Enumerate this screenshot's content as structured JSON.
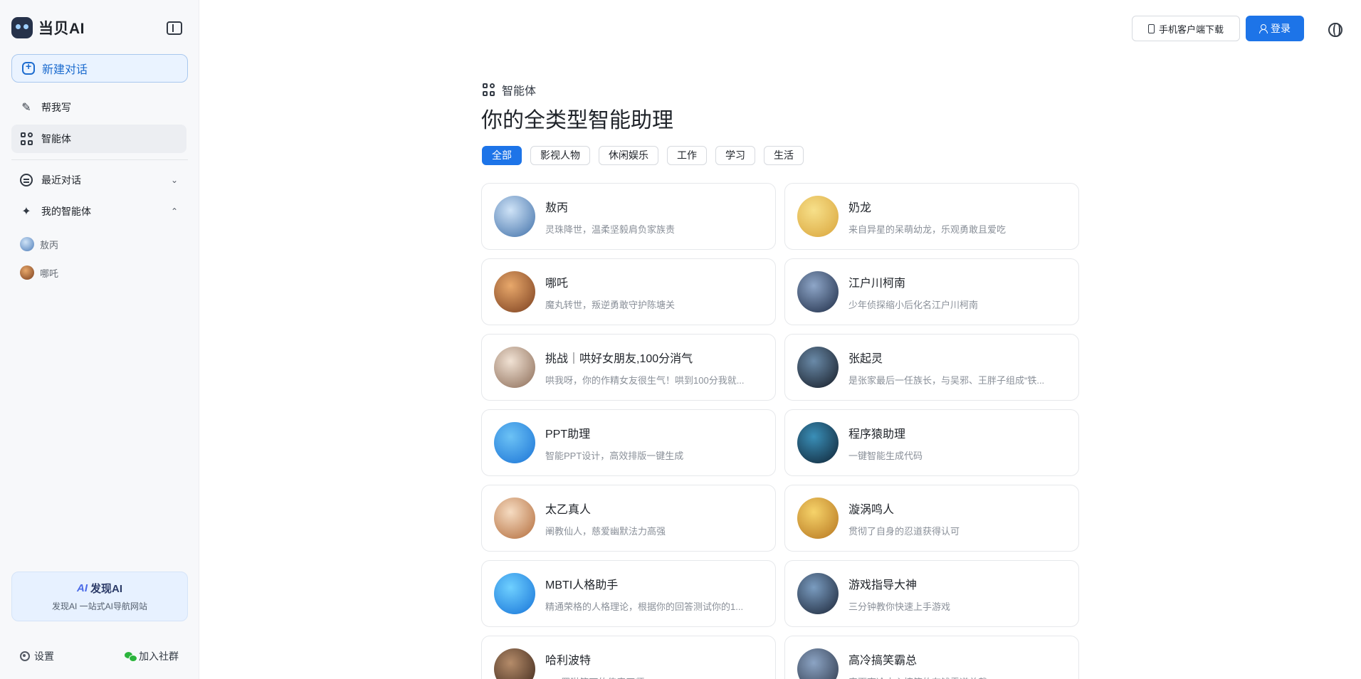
{
  "app": {
    "name": "当贝AI"
  },
  "sidebar": {
    "new_chat": "新建对话",
    "nav": {
      "write": "帮我写",
      "agents": "智能体",
      "recent": "最近对话",
      "my_agents": "我的智能体"
    },
    "my_agents": [
      {
        "label": "敖丙",
        "color": "#4d7cb8"
      },
      {
        "label": "哪吒",
        "color": "#a06038"
      }
    ],
    "promo": {
      "logo_mark": "AI",
      "logo_text": "发现AI",
      "text": "发现AI 一站式AI导航网站"
    },
    "settings": "设置",
    "join": "加入社群"
  },
  "header": {
    "download": "手机客户端下载",
    "login": "登录"
  },
  "main": {
    "section_tag": "智能体",
    "title": "你的全类型智能助理",
    "filters": [
      "全部",
      "影视人物",
      "休闲娱乐",
      "工作",
      "学习",
      "生活"
    ],
    "active_filter": "全部",
    "agents": [
      {
        "name": "敖丙",
        "desc": "灵珠降世，温柔坚毅肩负家族责",
        "colors": [
          "#cfe3f7",
          "#3f6fa8"
        ]
      },
      {
        "name": "奶龙",
        "desc": "来自异星的呆萌幼龙，乐观勇敢且爱吃",
        "colors": [
          "#f7e08a",
          "#d9a43a"
        ]
      },
      {
        "name": "哪吒",
        "desc": "魔丸转世，叛逆勇敢守护陈塘关",
        "colors": [
          "#e8a86b",
          "#7a3e1e"
        ]
      },
      {
        "name": "江户川柯南",
        "desc": "少年侦探缩小后化名江户川柯南",
        "colors": [
          "#8ea6c8",
          "#1d2b45"
        ]
      },
      {
        "name": "挑战｜哄好女朋友,100分消气",
        "desc": "哄我呀，你的作精女友很生气！哄到100分我就...",
        "colors": [
          "#f1e2d4",
          "#8a6a55"
        ]
      },
      {
        "name": "张起灵",
        "desc": "是张家最后一任族长，与吴邪、王胖子组成“铁...",
        "colors": [
          "#6a8aa8",
          "#141a24"
        ]
      },
      {
        "name": "PPT助理",
        "desc": "智能PPT设计，高效排版一键生成",
        "colors": [
          "#6cc2f5",
          "#1a73d6"
        ]
      },
      {
        "name": "程序猿助理",
        "desc": "一键智能生成代码",
        "colors": [
          "#3a8fb8",
          "#0f2233"
        ]
      },
      {
        "name": "太乙真人",
        "desc": "阐教仙人，慈爱幽默法力高强",
        "colors": [
          "#f6dcc2",
          "#b26b3a"
        ]
      },
      {
        "name": "漩涡鸣人",
        "desc": "贯彻了自身的忍道获得认可",
        "colors": [
          "#f6d36a",
          "#b5741e"
        ]
      },
      {
        "name": "MBTI人格助手",
        "desc": "精通荣格的人格理论，根据你的回答测试你的1...",
        "colors": [
          "#6fd0ff",
          "#1673d8"
        ]
      },
      {
        "name": "游戏指导大神",
        "desc": "三分钟教你快速上手游戏",
        "colors": [
          "#7a9cc0",
          "#1a2436"
        ]
      },
      {
        "name": "哈利波特",
        "desc": "J.K.罗琳笔下的传奇巫师",
        "colors": [
          "#b58c6a",
          "#3a2418"
        ]
      },
      {
        "name": "高冷搞笑霸总",
        "desc": "表面高冷内心搞笑的有钱霸道总裁",
        "colors": [
          "#8ca4c4",
          "#2a3446"
        ]
      }
    ]
  }
}
